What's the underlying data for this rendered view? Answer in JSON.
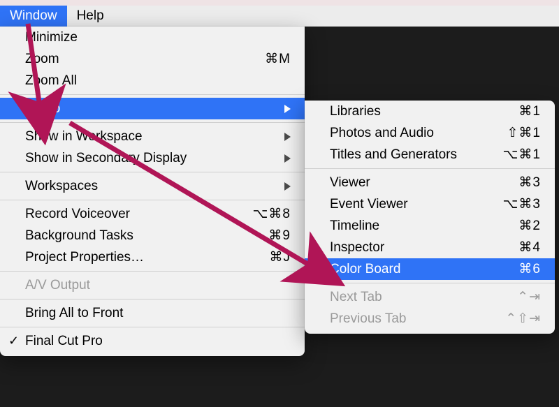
{
  "menubar": {
    "window": "Window",
    "help": "Help"
  },
  "main_menu": {
    "minimize": "Minimize",
    "zoom": "Zoom",
    "zoom_shortcut": "⌘M",
    "zoom_all": "Zoom All",
    "go_to": "Go To",
    "show_workspace": "Show in Workspace",
    "show_secondary": "Show in Secondary Display",
    "workspaces": "Workspaces",
    "record_vo": "Record Voiceover",
    "record_vo_sc": "⌥⌘8",
    "bg_tasks": "Background Tasks",
    "bg_tasks_sc": "⌘9",
    "proj_props": "Project Properties…",
    "proj_props_sc": "⌘J",
    "av_output": "A/V Output",
    "bring_front": "Bring All to Front",
    "fcp": "Final Cut Pro"
  },
  "sub_menu": {
    "libraries": "Libraries",
    "libraries_sc": "⌘1",
    "photos": "Photos and Audio",
    "photos_sc": "⇧⌘1",
    "titles": "Titles and Generators",
    "titles_sc": "⌥⌘1",
    "viewer": "Viewer",
    "viewer_sc": "⌘3",
    "event_viewer": "Event Viewer",
    "event_viewer_sc": "⌥⌘3",
    "timeline": "Timeline",
    "timeline_sc": "⌘2",
    "inspector": "Inspector",
    "inspector_sc": "⌘4",
    "color_board": "Color Board",
    "color_board_sc": "⌘6",
    "next_tab": "Next Tab",
    "next_tab_sc": "⌃⇥",
    "prev_tab": "Previous Tab",
    "prev_tab_sc": "⌃⇧⇥"
  },
  "annotation": {
    "arrow_color": "#b01556"
  }
}
